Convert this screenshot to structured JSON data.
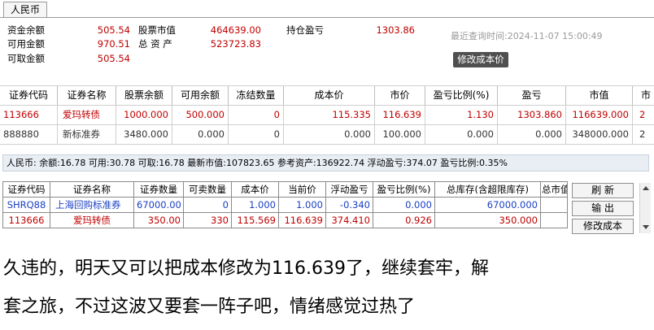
{
  "tab": {
    "label": "人民币"
  },
  "account": {
    "fund_balance_label": "资金余额",
    "fund_balance": "505.54",
    "available_label": "可用金额",
    "available": "970.51",
    "withdrawable_label": "可取金额",
    "withdrawable": "505.54",
    "stock_value_label": "股票市值",
    "stock_value": "464639.00",
    "total_assets_label": "总 资 产",
    "total_assets": "523723.83",
    "position_pnl_label": "持仓盈亏",
    "position_pnl": "1303.86",
    "last_query_label": "最近查询时间:",
    "last_query_time": "2024-11-07 15:00:49",
    "modify_cost_label": "修改成本价"
  },
  "top_table": {
    "headers": [
      "证券代码",
      "证券名称",
      "股票余额",
      "可用余额",
      "冻结数量",
      "成本价",
      "市价",
      "盈亏比例(%)",
      "盈亏",
      "市值",
      "市"
    ],
    "rows": [
      {
        "code": "113666",
        "name": "爱玛转债",
        "balance": "1000.000",
        "available": "500.000",
        "frozen": "0",
        "cost": "115.335",
        "price": "116.639",
        "pnl_pct": "1.130",
        "pnl": "1303.860",
        "value": "116639.000",
        "mkt": "2"
      },
      {
        "code": "888880",
        "name": "新标准券",
        "balance": "3480.000",
        "available": "0.000",
        "frozen": "0",
        "cost": "0.000",
        "price": "100.000",
        "pnl_pct": "0.000",
        "pnl": "0.000",
        "value": "348000.000",
        "mkt": "2"
      }
    ]
  },
  "info_bar": "人民币: 余额:16.78  可用:30.78  可取:16.78  最新市值:107823.65  参考资产:136922.74  浮动盈亏:374.07  盈亏比例:0.35%",
  "lower_table": {
    "headers": [
      "证券代码",
      "证券名称",
      "证券数量",
      "可卖数量",
      "成本价",
      "当前价",
      "浮动盈亏",
      "盈亏比例(%)",
      "总库存(含超限库存)",
      "总市值"
    ],
    "rows": [
      {
        "code": "SHRQ88",
        "name": "上海回购标准券",
        "qty": "67000.00",
        "sellable": "0",
        "cost": "1.000",
        "price": "1.000",
        "float_pnl": "-0.340",
        "pnl_pct": "0.000",
        "inventory": "67000.000",
        "mv": ""
      },
      {
        "code": "113666",
        "name": "爱玛转债",
        "qty": "350.00",
        "sellable": "330",
        "cost": "115.569",
        "price": "116.639",
        "float_pnl": "374.410",
        "pnl_pct": "0.926",
        "inventory": "350.000",
        "mv": ""
      }
    ]
  },
  "side_buttons": {
    "refresh": "刷 新",
    "export": "输 出",
    "modify_cost": "修改成本"
  },
  "caption": {
    "line1": "久违的，明天又可以把成本修改为116.639了，继续套牢，解",
    "line2": "套之旅，不过这波又要套一阵子吧，情绪感觉过热了"
  }
}
